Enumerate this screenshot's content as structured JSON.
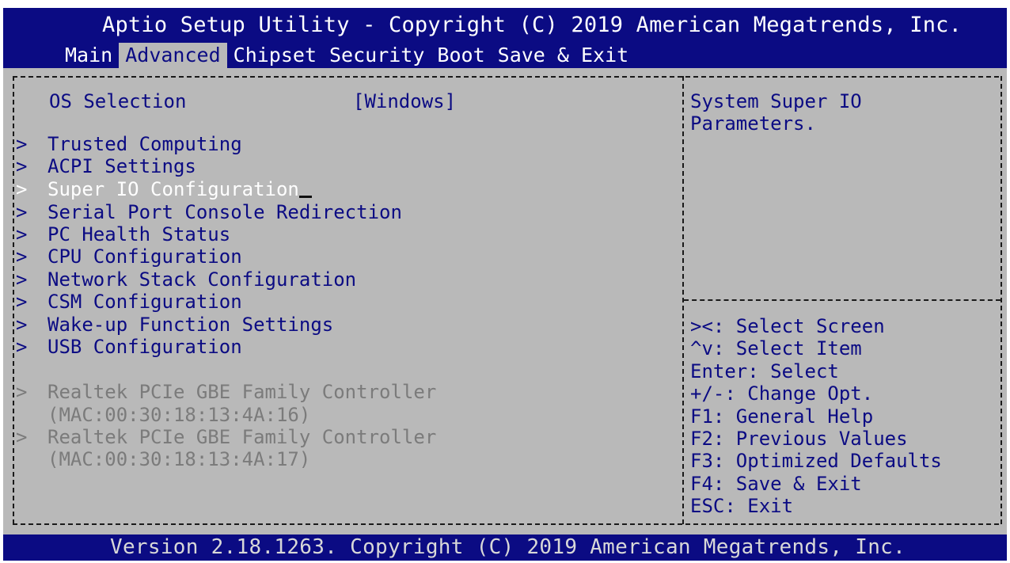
{
  "header": {
    "title": "Aptio Setup Utility - Copyright (C) 2019 American Megatrends, Inc.",
    "tabs": [
      {
        "label": "Main"
      },
      {
        "label": "Advanced",
        "active": true
      },
      {
        "label": "Chipset"
      },
      {
        "label": "Security"
      },
      {
        "label": "Boot"
      },
      {
        "label": "Save & Exit"
      }
    ]
  },
  "settings": {
    "os_selection": {
      "label": "OS Selection",
      "value": "[Windows]"
    },
    "submenus": [
      {
        "label": "Trusted Computing"
      },
      {
        "label": "ACPI Settings"
      },
      {
        "label": "Super IO Configuration",
        "selected": true
      },
      {
        "label": "Serial Port Console Redirection"
      },
      {
        "label": "PC Health Status"
      },
      {
        "label": "CPU Configuration"
      },
      {
        "label": "Network Stack Configuration"
      },
      {
        "label": "CSM Configuration"
      },
      {
        "label": "Wake-up Function Settings"
      },
      {
        "label": "USB Configuration"
      }
    ],
    "nic_entries": [
      {
        "label": "Realtek PCIe GBE Family Controller",
        "mac": "(MAC:00:30:18:13:4A:16)"
      },
      {
        "label": "Realtek PCIe GBE Family Controller",
        "mac": "(MAC:00:30:18:13:4A:17)"
      }
    ],
    "arrow_glyph": ">"
  },
  "help": {
    "description_line1": "System Super IO",
    "description_line2": "Parameters.",
    "keys": [
      "><: Select Screen",
      "^v: Select Item",
      "Enter: Select",
      "+/-: Change Opt.",
      "F1: General Help",
      "F2: Previous Values",
      "F3: Optimized Defaults",
      "F4: Save & Exit",
      "ESC: Exit"
    ]
  },
  "footer": {
    "text": "Version 2.18.1263. Copyright (C) 2019 American Megatrends, Inc."
  },
  "colors": {
    "header_bg": "#0b0b83",
    "panel_bg": "#b9b9b9",
    "text_blue": "#0b0b83",
    "selected_text": "#ffffff",
    "disabled_text": "#7b7b7b"
  }
}
